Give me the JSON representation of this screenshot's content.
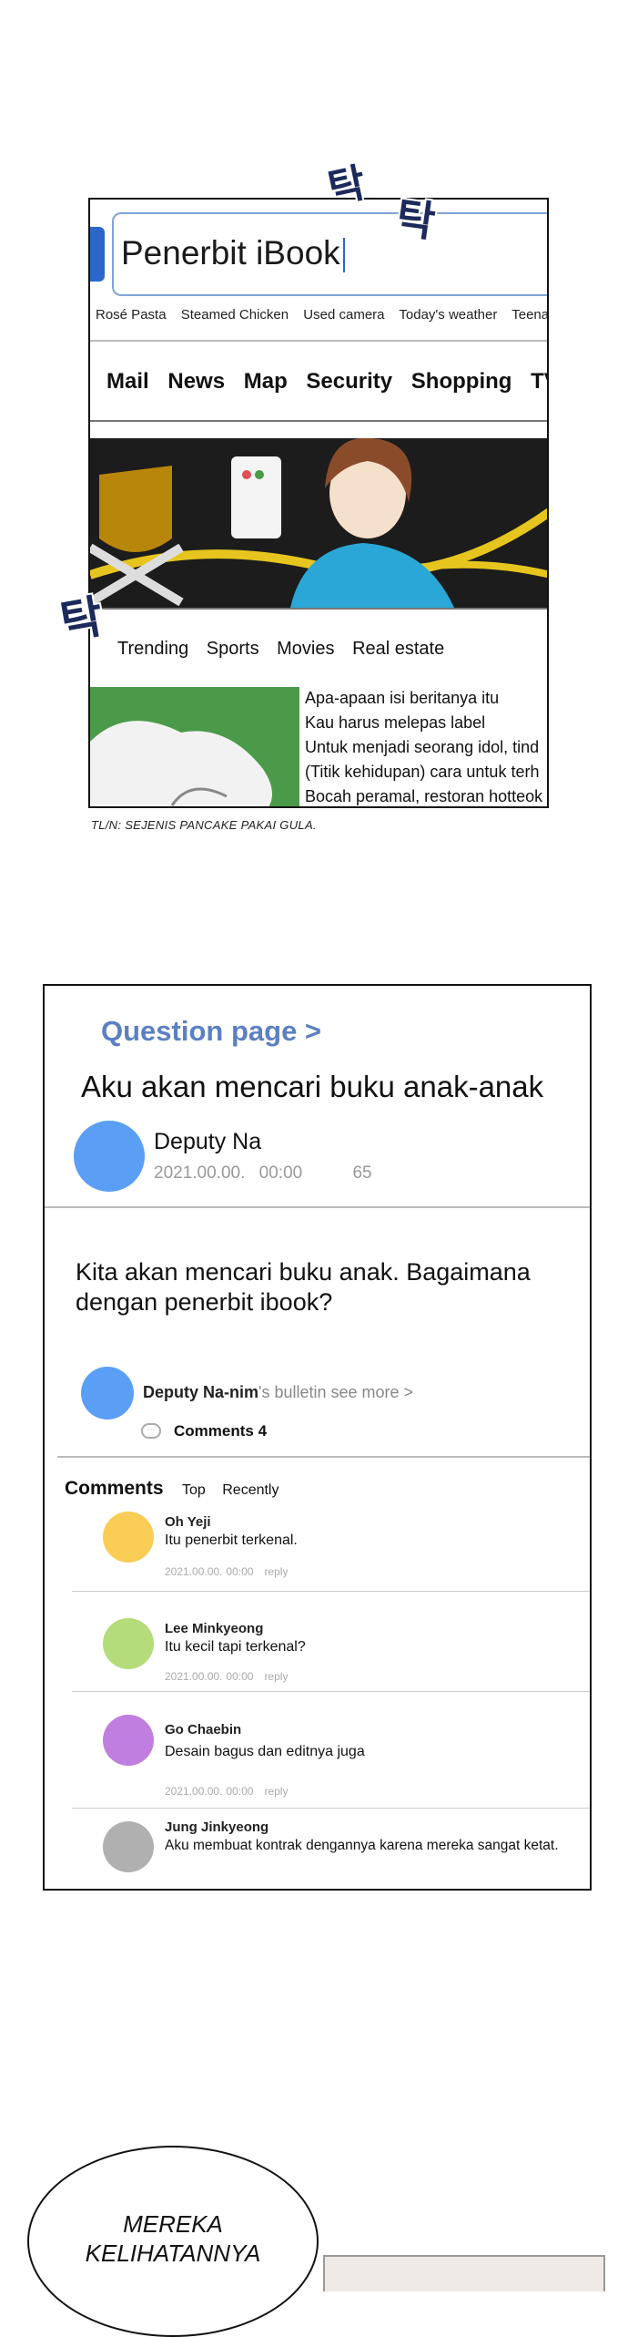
{
  "panel1": {
    "search_text": "Penerbit iBook",
    "trending": [
      "Rosé Pasta",
      "Steamed Chicken",
      "Used camera",
      "Today's weather",
      "Teenage tre"
    ],
    "nav": [
      "Mail",
      "News",
      "Map",
      "Security",
      "Shopping",
      "TV"
    ],
    "sub_nav": [
      "Trending",
      "Sports",
      "Movies",
      "Real estate"
    ],
    "news": [
      "Apa-apaan isi beritanya itu",
      "Kau harus melepas label",
      "Untuk menjadi seorang idol, tind",
      "(Titik kehidupan) cara untuk terh",
      "Bocah peramal, restoran hotteok"
    ],
    "sfx": [
      "탁",
      "탁",
      "탁"
    ]
  },
  "tl_note": "TL/N: SEJENIS PANCAKE PAKAI GULA.",
  "panel2": {
    "crumb": "Question page >",
    "title": "Aku akan mencari buku anak-anak",
    "author": {
      "name": "Deputy Na",
      "date": "2021.00.00.",
      "time": "00:00",
      "views": "65",
      "avatar_color": "#5a9ef5"
    },
    "question": "Kita akan mencari buku anak. Bagaimana dengan penerbit ibook?",
    "bulletin_name": "Deputy Na-nim",
    "bulletin_rest": "'s bulletin see more >",
    "comments_count": "Comments 4",
    "tabs": [
      "Comments",
      "Top",
      "Recently"
    ],
    "comments": [
      {
        "name": "Oh Yeji",
        "text": "Itu penerbit terkenal.",
        "date": "2021.00.00.",
        "time": "00:00",
        "reply": "reply",
        "color": "#f9cd55"
      },
      {
        "name": "Lee Minkyeong",
        "text": "Itu kecil tapi terkenal?",
        "date": "2021.00.00.",
        "time": "00:00",
        "reply": "reply",
        "color": "#b4dc7a"
      },
      {
        "name": "Go Chaebin",
        "text": "Desain bagus dan editnya juga",
        "date": "2021.00.00.",
        "time": "00:00",
        "reply": "reply",
        "color": "#c07ee0"
      },
      {
        "name": "Jung Jinkyeong",
        "text": "Aku membuat kontrak dengannya karena mereka sangat ketat.",
        "date": "",
        "time": "",
        "reply": "",
        "color": "#b0b0b0"
      }
    ]
  },
  "bottom": {
    "speech": "MEREKA KELIHATANNYA"
  }
}
